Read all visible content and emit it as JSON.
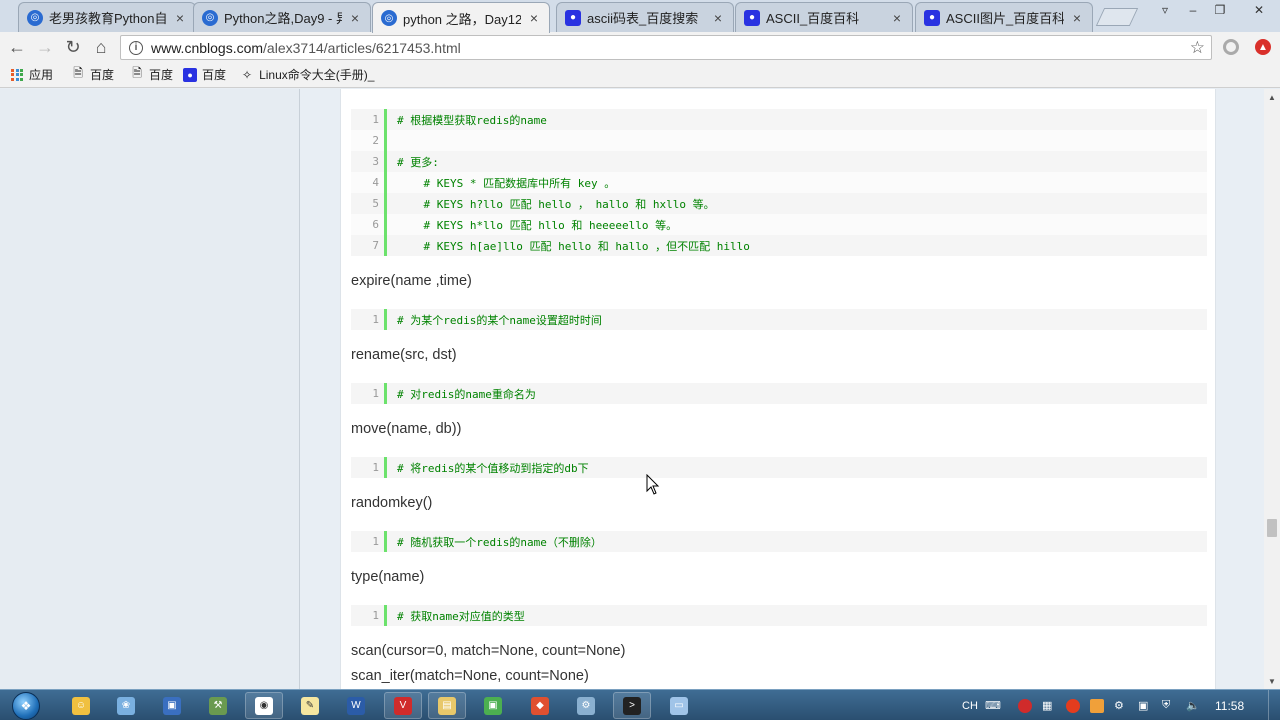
{
  "tabs": [
    {
      "title": "老男孩教育Python自",
      "icon": "cnblogs-icon"
    },
    {
      "title": "Python之路,Day9 - 异",
      "icon": "cnblogs-icon"
    },
    {
      "title": "python 之路，Day12",
      "icon": "cnblogs-icon",
      "active": true
    },
    {
      "title": "ascii码表_百度搜索",
      "icon": "baidu-paw-icon"
    },
    {
      "title": "ASCII_百度百科",
      "icon": "baidu-paw-icon"
    },
    {
      "title": "ASCII图片_百度百科",
      "icon": "baidu-paw-icon"
    }
  ],
  "address": {
    "host": "www.cnblogs.com",
    "path": "/alex3714/articles/6217453.html"
  },
  "bookmarks": [
    {
      "label": "应用",
      "icon": "apps-grid-icon"
    },
    {
      "label": "百度",
      "icon": "page-icon"
    },
    {
      "label": "百度",
      "icon": "page-icon"
    },
    {
      "label": "百度",
      "icon": "baidu-paw-icon"
    },
    {
      "label": "Linux命令大全(手册)_",
      "icon": "linux-icon"
    }
  ],
  "blocks": [
    {
      "kind": "code",
      "lines": [
        {
          "n": "1",
          "text": "# 根据模型获取redis的name"
        },
        {
          "n": "2",
          "text": ""
        },
        {
          "n": "3",
          "text": "# 更多:"
        },
        {
          "n": "4",
          "text": "    # KEYS * 匹配数据库中所有 key 。"
        },
        {
          "n": "5",
          "text": "    # KEYS h?llo 匹配 hello ， hallo 和 hxllo 等。"
        },
        {
          "n": "6",
          "text": "    # KEYS h*llo 匹配 hllo 和 heeeeello 等。"
        },
        {
          "n": "7",
          "text": "    # KEYS h[ae]llo 匹配 hello 和 hallo ，但不匹配 hillo"
        }
      ]
    },
    {
      "kind": "heading",
      "text": "expire(name ,time)"
    },
    {
      "kind": "code",
      "lines": [
        {
          "n": "1",
          "text": "# 为某个redis的某个name设置超时时间"
        }
      ]
    },
    {
      "kind": "heading",
      "text": "rename(src, dst)"
    },
    {
      "kind": "code",
      "lines": [
        {
          "n": "1",
          "text": "# 对redis的name重命名为"
        }
      ]
    },
    {
      "kind": "heading",
      "text": "move(name, db))"
    },
    {
      "kind": "code",
      "lines": [
        {
          "n": "1",
          "text": "# 将redis的某个值移动到指定的db下"
        }
      ]
    },
    {
      "kind": "heading",
      "text": "randomkey()"
    },
    {
      "kind": "code",
      "lines": [
        {
          "n": "1",
          "text": "# 随机获取一个redis的name（不删除）"
        }
      ]
    },
    {
      "kind": "heading",
      "text": "type(name)"
    },
    {
      "kind": "code",
      "lines": [
        {
          "n": "1",
          "text": "# 获取name对应值的类型"
        }
      ]
    },
    {
      "kind": "heading",
      "text": "scan(cursor=0, match=None, count=None)"
    },
    {
      "kind": "heading",
      "text": "scan_iter(match=None, count=None)"
    }
  ],
  "taskbar": {
    "apps": [
      "folder-icon",
      "paint-icon",
      "save-icon",
      "tools-icon",
      "chrome-icon",
      "notepad-icon",
      "word-icon",
      "vpn-icon",
      "explorer-icon",
      "pycharm-icon",
      "red-app-icon",
      "tool2-icon",
      "cmd-icon",
      "window-icon"
    ],
    "tray_lang": "CH",
    "clock": "11:58"
  }
}
